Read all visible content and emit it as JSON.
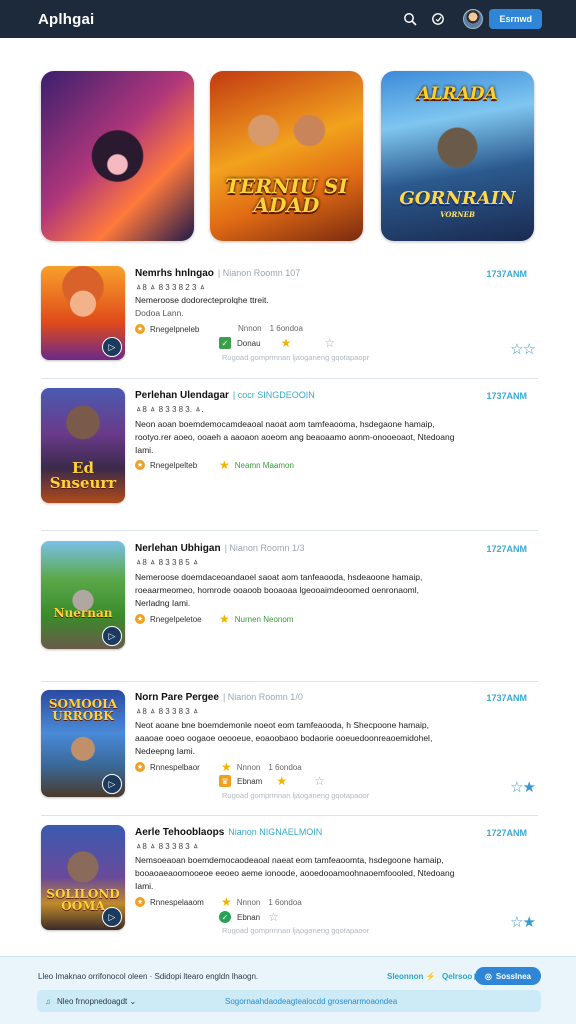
{
  "header": {
    "brand": "Aplhgai",
    "button_label": "Esrnwd",
    "icons": [
      "search-icon",
      "notification-icon",
      "avatar"
    ]
  },
  "hero": [
    {
      "title": ""
    },
    {
      "title": "TERNIU SI ADAD"
    },
    {
      "title_top": "ALRADA",
      "title": "GORNRAIN",
      "subtitle": "VORNEB"
    }
  ],
  "cards": [
    {
      "thumb_title": "",
      "name": "Nemrhs hnlngao",
      "meta": "| Nianon Roomn 107",
      "time": "1737ANM",
      "sub": "ㅿ8 ㅿ 8 3 3 8 2 3 ㅿ",
      "desc": "Nemeroose dodorecteprolqhe ttreit.",
      "desc2": "Dodoa Lann.",
      "tag": "Rnegelpneleb",
      "stat_label": "Nnnon",
      "stat_value": "1 6ondoa",
      "stat2_label": "Donau",
      "muted": "Rugoad gomprmnan ljaoganeng gqotapaopr"
    },
    {
      "thumb_title": "Ed Snseurr",
      "name": "Perlehan Ulendagar",
      "meta": "| cocr SINGDEOOIN",
      "time": "1737ANM",
      "sub": "ㅿ8 ㅿ 8 3 3 8 3. ㅿ.",
      "desc": "Neon aoan boemdemocamdeaoal naoat aom tamfeaooma, hsdegaone hamaip, rootyo.rer aoeo, ooaeh a aaoaon aoeom ang beaoaamo aonm-onooeoaot, Ntedoang Iami.",
      "tag": "Rnegelpelteb",
      "tag2": "Neamn Maamon"
    },
    {
      "thumb_title": "Nuernan",
      "name": "Nerlehan Ubhigan",
      "meta": "| Nianon Roomn 1/3",
      "time": "1727ANM",
      "sub": "ㅿ8 ㅿ 8 3 3 8 5 ㅿ",
      "desc": "Nemeroose doemdaceoandaoel saoat aom tanfeaooda, hsdeaoone hamaip, roeaarmeomeo, homrode ooaoob booaoaa lgeooaimdeoomed oenronaoml, Nerladng Iami.",
      "tag": "Rnegelpeletoe",
      "tag2": "Nurnen Neonom"
    },
    {
      "thumb_title": "SOMOOIA URROBK",
      "name": "Norn Pare Pergee",
      "meta": "| Nianon Roomn 1/0",
      "time": "1737ANM",
      "sub": "ㅿ8 ㅿ 8 3 3 8 3 ㅿ",
      "desc": "Neot aoane bne boemdemonle noeot eom tamfeaooda, h Shecpoone hamaip, aaaoae ooeo oogaoe oeooeue, eoaoobaoo bodaorie ooeuedoonreaoemidohel, Nedeepng Iami.",
      "tag": "Rnnespelbaor",
      "stat_label": "Nnnon",
      "stat_value": "1 6ondoa",
      "stat2_label": "Ebnam",
      "muted": "Rugoad gomprmnan ljaoganeng gqotapaoor"
    },
    {
      "thumb_title": "SOLILOND OOMA",
      "name": "Aerle Tehooblaops",
      "meta": "Nianon NIGNAELMOIN",
      "time": "1727ANM",
      "sub": "ㅿ8 ㅿ 8 3 3 8 3 ㅿ",
      "desc": "Nemsoeaoan boemdemocaodeaoal naeat eom tamfeaoomta, hsdegoone hamaip, booaoaeaoomooeoe eeoeo aeme ionoode, aooedooamoohnaoemfoooled, Ntedoang Iami.",
      "tag": "Rnnespelaaom",
      "stat_label": "Nnnon",
      "stat_value": "1 6ondoa",
      "stat2_label": "Ebnan",
      "muted": "Rugoad gomprmnan ljaoganeng gqotapaoor"
    }
  ],
  "footer": {
    "text": "Lleo Imaknao orrifonocol oleen · Sdidopi ltearo engldn lhaogn.",
    "link1": "Sleonnon ⚡",
    "link2": "Qelrsoo ▶",
    "button": "Sosslnea",
    "select": "Nleo frnopnedoagdt ⌄",
    "center": "Sogornaahdaodeagtealocdd grosenarmoaondea"
  },
  "colors": {
    "topbar": "#1d2a3b",
    "accent": "#2f86d6",
    "teal": "#3aa9d8"
  }
}
